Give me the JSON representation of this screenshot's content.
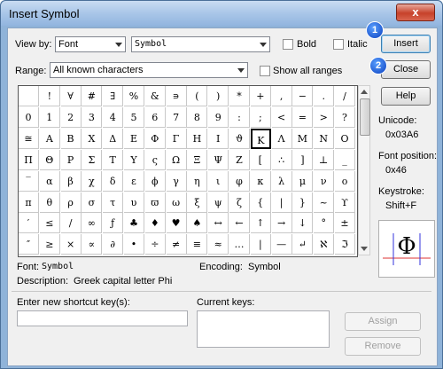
{
  "window": {
    "title": "Insert Symbol",
    "close_glyph": "x"
  },
  "toolbar": {
    "view_by_label": "View by:",
    "view_by_value": "Font",
    "font_value": "Symbol",
    "bold_label": "Bold",
    "italic_label": "Italic",
    "range_label": "Range:",
    "range_value": "All known characters",
    "show_all_ranges_label": "Show all ranges"
  },
  "buttons": {
    "insert": "Insert",
    "close": "Close",
    "help": "Help",
    "assign": "Assign",
    "remove": "Remove"
  },
  "badges": [
    "1",
    "2"
  ],
  "info": {
    "unicode_label": "Unicode:",
    "unicode_value": "0x03A6",
    "font_position_label": "Font position:",
    "font_position_value": "0x46",
    "keystroke_label": "Keystroke:",
    "keystroke_value": "Shift+F",
    "preview_char": "Φ"
  },
  "status": {
    "font_label": "Font:",
    "font_value": "Symbol",
    "encoding_label": "Encoding:",
    "encoding_value": "Symbol",
    "description_label": "Description:",
    "description_value": "Greek capital letter Phi"
  },
  "shortcut": {
    "new_key_label": "Enter new shortcut key(s):",
    "current_keys_label": "Current keys:"
  },
  "grid": {
    "selected_index": 43,
    "rows": [
      [
        "",
        "!",
        "∀",
        "#",
        "∃",
        "%",
        "&",
        "∍",
        "(",
        ")",
        "*",
        "+",
        ",",
        "−",
        ".",
        "/"
      ],
      [
        "0",
        "1",
        "2",
        "3",
        "4",
        "5",
        "6",
        "7",
        "8",
        "9",
        ":",
        ";",
        "<",
        "=",
        ">",
        "?"
      ],
      [
        "≅",
        "A",
        "B",
        "X",
        "Δ",
        "E",
        "Φ",
        "Γ",
        "H",
        "I",
        "ϑ",
        "K",
        "Λ",
        "M",
        "N",
        "O"
      ],
      [
        "Π",
        "Θ",
        "P",
        "Σ",
        "T",
        "Y",
        "ς",
        "Ω",
        "Ξ",
        "Ψ",
        "Z",
        "[",
        "∴",
        "]",
        "⊥",
        "_"
      ],
      [
        "‾",
        "α",
        "β",
        "χ",
        "δ",
        "ε",
        "ϕ",
        "γ",
        "η",
        "ι",
        "φ",
        "κ",
        "λ",
        "μ",
        "ν",
        "ο"
      ],
      [
        "π",
        "θ",
        "ρ",
        "σ",
        "τ",
        "υ",
        "ϖ",
        "ω",
        "ξ",
        "ψ",
        "ζ",
        "{",
        "|",
        "}",
        "~",
        "ϒ"
      ],
      [
        "′",
        "≤",
        "/",
        "∞",
        "ƒ",
        "♣",
        "♦",
        "♥",
        "♠",
        "↔",
        "←",
        "↑",
        "→",
        "↓",
        "°",
        "±"
      ],
      [
        "″",
        "≥",
        "×",
        "∝",
        "∂",
        "•",
        "÷",
        "≠",
        "≡",
        "≈",
        "…",
        "|",
        "—",
        "↵",
        "ℵ",
        "ℑ"
      ]
    ]
  }
}
